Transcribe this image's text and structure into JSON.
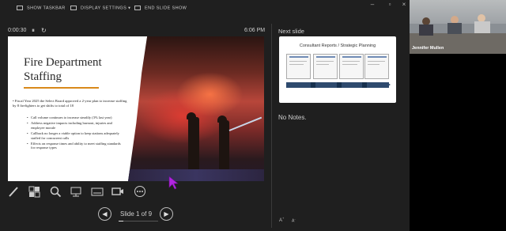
{
  "topbar": {
    "show_taskbar": "SHOW TASKBAR",
    "display_settings": "DISPLAY SETTINGS ▾",
    "end_slide_show": "END SLIDE SHOW"
  },
  "presenter": {
    "elapsed": "0:00:30",
    "clock": "6:06 PM",
    "slide_counter": "Slide 1 of 9",
    "progress_fraction": 0.11
  },
  "current_slide": {
    "title_line1": "Fire Department",
    "title_line2": "Staffing",
    "main_bullet": "Fiscal Year 2025 the Select Board approved a 2-year plan to increase staffing by 8 firefighters to get shifts to total of 18",
    "sub_bullets": [
      "Call volume continues to increase steadily (3% last year)",
      "Address negative impacts including burnout, injuries and employee morale",
      "Callback no longer a viable option to keep stations adequately staffed for concurrent calls",
      "Effects on response times and ability to meet staffing standards for response types"
    ],
    "accent_color": "#d9891b"
  },
  "next_slide": {
    "label": "Next slide",
    "thumbnail_title": "Consultant Reports / Strategic Planning"
  },
  "notes": {
    "text": "No Notes."
  },
  "toolbar_icons": [
    "pen-icon",
    "slides-grid-icon",
    "zoom-icon",
    "pointer-screen-icon",
    "subtitles-icon",
    "camera-icon",
    "more-icon"
  ],
  "font_controls": {
    "increase": "A",
    "decrease": "A"
  },
  "video": {
    "participant_name": "Jennifer Mullen"
  }
}
